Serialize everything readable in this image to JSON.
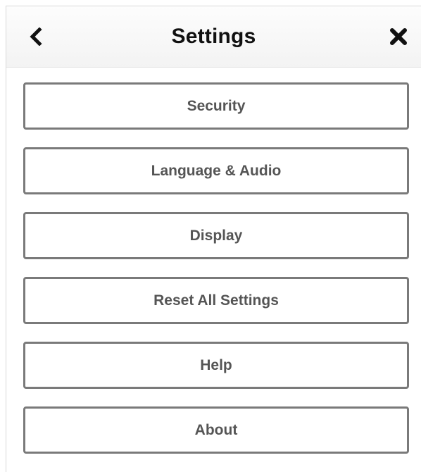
{
  "header": {
    "title": "Settings",
    "back_icon": "chevron-left-icon",
    "close_icon": "close-icon"
  },
  "menu": {
    "items": [
      {
        "label": "Security"
      },
      {
        "label": "Language & Audio"
      },
      {
        "label": "Display"
      },
      {
        "label": "Reset All Settings"
      },
      {
        "label": "Help"
      },
      {
        "label": "About"
      }
    ]
  },
  "colors": {
    "button_border": "#7a7a7a",
    "button_text": "#555555",
    "title_text": "#111111",
    "header_bg": "#f6f6f6"
  }
}
